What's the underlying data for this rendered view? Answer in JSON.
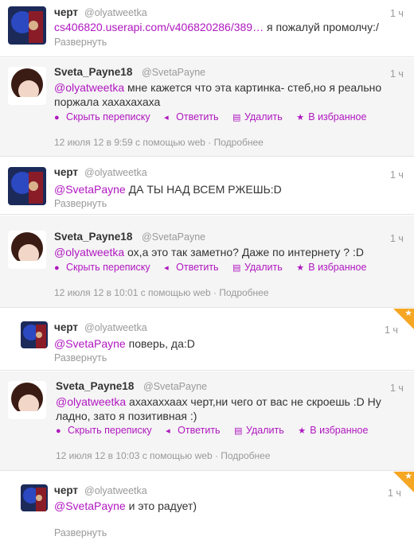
{
  "tweets": [
    {
      "name": "черт",
      "handle": "@olyatweetka",
      "time": "1 ч",
      "link_text": "cs406820.userapi.com/v406820286/389…",
      "rest_text": " я пожалуй промолчу:/",
      "expand": "Развернуть"
    },
    {
      "name": "Sveta_Payne18",
      "handle": "@SvetaPayne",
      "time": "1 ч",
      "mention": "@olyatweetka",
      "text_line1": " мне кажется что эта картинка- стеб,но я реально",
      "text_line2": "поржала хахахахаха",
      "meta": "12 июля 12 в 9:59 с помощью web · Подробнее"
    },
    {
      "name": "черт",
      "handle": "@olyatweetka",
      "time": "1 ч",
      "mention": "@SvetaPayne",
      "text": " ДА ТЫ НАД ВСЕМ РЖЕШЬ:D",
      "expand": "Развернуть"
    },
    {
      "name": "Sveta_Payne18",
      "handle": "@SvetaPayne",
      "time": "1 ч",
      "mention": "@olyatweetka",
      "text": " ох,а это так заметно? Даже по интернету ? :D",
      "meta": "12 июля 12 в 10:01 с помощью web · Подробнее"
    },
    {
      "name": "черт",
      "handle": "@olyatweetka",
      "time": "1 ч",
      "mention": "@SvetaPayne",
      "text": " поверь, да:D",
      "expand": "Развернуть"
    },
    {
      "name": "Sveta_Payne18",
      "handle": "@SvetaPayne",
      "time": "1 ч",
      "mention": "@olyatweetka",
      "text_line1": " ахахаххаах черт,ни чего от вас не скроешь :D Ну",
      "text_line2": "ладно, зато я позитивная :)",
      "meta": "12 июля 12 в 10:03 с помощью web · Подробнее"
    },
    {
      "name": "черт",
      "handle": "@olyatweetka",
      "time": "1 ч",
      "mention": "@SvetaPayne",
      "text": " и это радует)",
      "expand": "Развернуть"
    }
  ],
  "actions": {
    "hide_conversation": "Скрыть переписку",
    "reply": "Ответить",
    "delete": "Удалить",
    "favorite": "В избранное"
  },
  "icons": {
    "hide": "speech-bubble-icon",
    "reply": "reply-arrow-icon",
    "delete": "trash-icon",
    "favorite": "star-icon",
    "favorited_corner": "favorite-star-corner-icon"
  },
  "colors": {
    "accent": "#b017c0",
    "muted": "#999999",
    "favorited": "#f5a623"
  }
}
